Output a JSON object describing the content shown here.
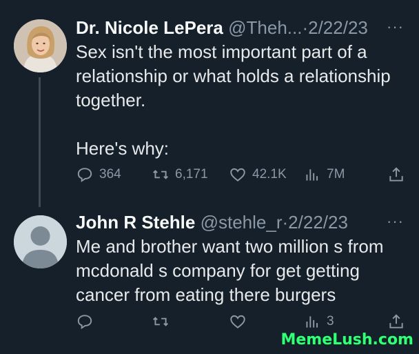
{
  "tweets": [
    {
      "name": "Dr. Nicole LePera",
      "handle": "@Theh...",
      "separator": "·",
      "date": "2/22/23",
      "more": "···",
      "body": [
        "Sex isn't the most important part of a relationship or what holds a relationship together.",
        "Here's why:"
      ],
      "stats": {
        "replies": "364",
        "retweets": "6,171",
        "likes": "42.1K",
        "views": "7M"
      }
    },
    {
      "name": "John R Stehle",
      "handle": "@stehle_r",
      "separator": "·",
      "date": "2/22/23",
      "more": "···",
      "body": [
        "Me and brother want two million s from mcdonald s company for get getting cancer from eating there burgers"
      ],
      "stats": {
        "replies": "",
        "retweets": "",
        "likes": "",
        "views": "3"
      }
    }
  ],
  "icons": {
    "reply": "reply-icon",
    "retweet": "retweet-icon",
    "like": "heart-icon",
    "views": "views-icon",
    "share": "share-icon"
  },
  "watermark": "MemeLush.com",
  "colors": {
    "background": "#15202b",
    "text": "#e7e9ea",
    "muted": "#8b98a5",
    "watermark": "#32ff7a"
  }
}
